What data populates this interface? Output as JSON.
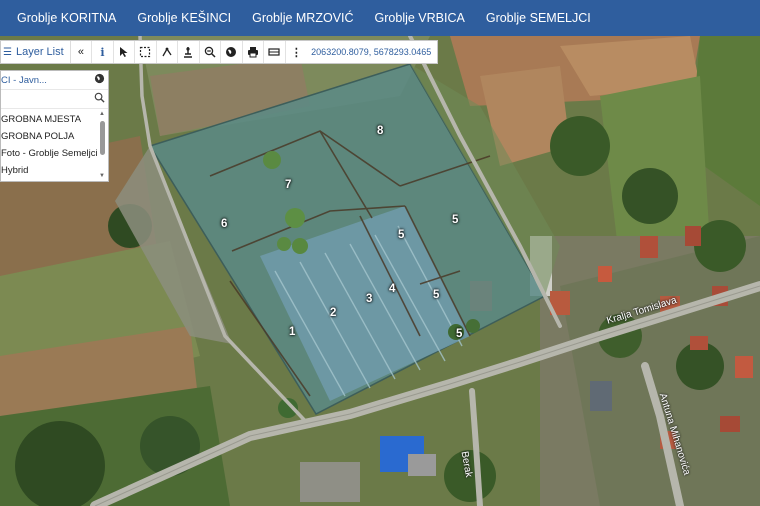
{
  "nav": {
    "items": [
      "Groblje KORITNA",
      "Groblje KEŠINCI",
      "Groblje MRZOVIĆ",
      "Groblje VRBICA",
      "Groblje SEMELJCI"
    ]
  },
  "toolbar": {
    "layer_list_label": "Layer List",
    "collapse_icon": "«",
    "info_icon": "i",
    "coordinates": "2063200.8079, 5678293.0465"
  },
  "layer_panel": {
    "selected_layer": "CI - Javn...",
    "layers": [
      "GROBNA MJESTA",
      "GROBNA POLJA",
      "Foto - Groblje Semeljci",
      "Hybrid"
    ]
  },
  "map": {
    "field_labels": [
      "8",
      "7",
      "6",
      "5",
      "5",
      "5",
      "4",
      "3",
      "2",
      "1",
      "5"
    ],
    "streets": [
      "Kralja Tomislava",
      "Antuna Mihanovića",
      "Berak"
    ]
  }
}
